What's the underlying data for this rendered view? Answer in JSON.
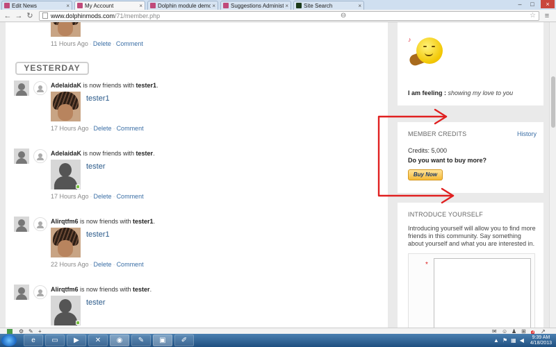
{
  "browser": {
    "tabs": [
      {
        "label": "Edit News",
        "active": false,
        "icon": "dolphin-favicon"
      },
      {
        "label": "My Account",
        "active": true,
        "icon": "dolphin-favicon"
      },
      {
        "label": "Dolphin module demo sit",
        "active": false,
        "icon": "dolphin-favicon"
      },
      {
        "label": "Suggestions Administratio",
        "active": false,
        "icon": "dolphin-favicon"
      },
      {
        "label": "Site Search",
        "active": false,
        "icon": "site-favicon"
      }
    ],
    "url_host": "www.dolphinmods.com",
    "url_path": "/71/member.php"
  },
  "feed": {
    "top_item": {
      "time": "11 Hours Ago",
      "delete_label": "Delete",
      "comment_label": "Comment"
    },
    "day_label": "YESTERDAY",
    "items": [
      {
        "actor": "AdelaidaK",
        "action": " is now friends with ",
        "friend": "tester1",
        "period": ".",
        "thumb": "photo",
        "time": "17 Hours Ago",
        "delete_label": "Delete",
        "comment_label": "Comment"
      },
      {
        "actor": "AdelaidaK",
        "action": " is now friends with ",
        "friend": "tester",
        "period": ".",
        "thumb": "gray",
        "time": "17 Hours Ago",
        "delete_label": "Delete",
        "comment_label": "Comment"
      },
      {
        "actor": "Alirqtfm6",
        "action": " is now friends with ",
        "friend": "tester1",
        "period": ".",
        "thumb": "photo",
        "time": "22 Hours Ago",
        "delete_label": "Delete",
        "comment_label": "Comment"
      },
      {
        "actor": "Alirqtfm6",
        "action": " is now friends with ",
        "friend": "tester",
        "period": ".",
        "thumb": "gray",
        "time": "",
        "delete_label": "",
        "comment_label": ""
      }
    ]
  },
  "sidebar": {
    "mood": {
      "feeling_label": "I am feeling :",
      "feeling_value": "showing my love to you"
    },
    "credits": {
      "title": "MEMBER CREDITS",
      "history_label": "History",
      "credits_text": "Credits: 5,000",
      "buy_prompt": "Do you want to buy more?",
      "buy_button": "Buy Now"
    },
    "intro": {
      "title": "INTRODUCE YOURSELF",
      "description": "Introducing yourself will allow you to find more friends in this community. Say something about yourself and what you are interested in.",
      "required_mark": "*"
    }
  },
  "taskbar": {
    "time": "9:39 AM",
    "date": "4/18/2013"
  },
  "colors": {
    "annotation_arrow": "#e02020",
    "link": "#3a6ea5",
    "online_indicator": "#7ac043"
  }
}
